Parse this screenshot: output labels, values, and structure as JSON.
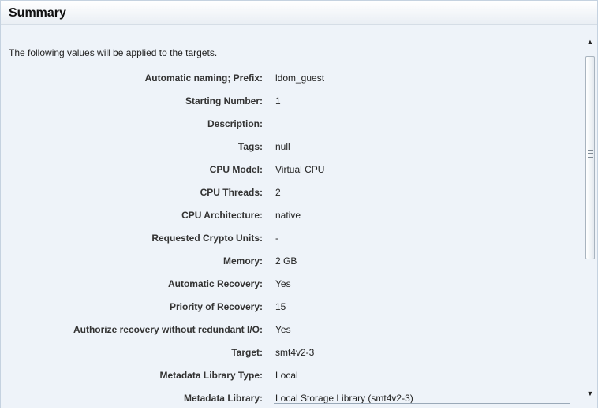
{
  "summary": {
    "title": "Summary",
    "intro": "The following values will be applied to the targets.",
    "rows": [
      {
        "label": "Automatic naming; Prefix:",
        "value": "ldom_guest"
      },
      {
        "label": "Starting Number:",
        "value": "1"
      },
      {
        "label": "Description:",
        "value": ""
      },
      {
        "label": "Tags:",
        "value": "null"
      },
      {
        "label": "CPU Model:",
        "value": "Virtual CPU"
      },
      {
        "label": "CPU Threads:",
        "value": "2"
      },
      {
        "label": "CPU Architecture:",
        "value": "native"
      },
      {
        "label": "Requested Crypto Units:",
        "value": "-"
      },
      {
        "label": "Memory:",
        "value": "2 GB"
      },
      {
        "label": "Automatic Recovery:",
        "value": "Yes"
      },
      {
        "label": "Priority of Recovery:",
        "value": "15"
      },
      {
        "label": "Authorize recovery without redundant I/O:",
        "value": "Yes"
      },
      {
        "label": "Target:",
        "value": "smt4v2-3"
      },
      {
        "label": "Metadata Library Type:",
        "value": "Local"
      },
      {
        "label": "Metadata Library:",
        "value": "Local Storage Library (smt4v2-3)"
      }
    ]
  },
  "scrollbar": {
    "up_icon": "▲",
    "down_icon": "▼"
  }
}
